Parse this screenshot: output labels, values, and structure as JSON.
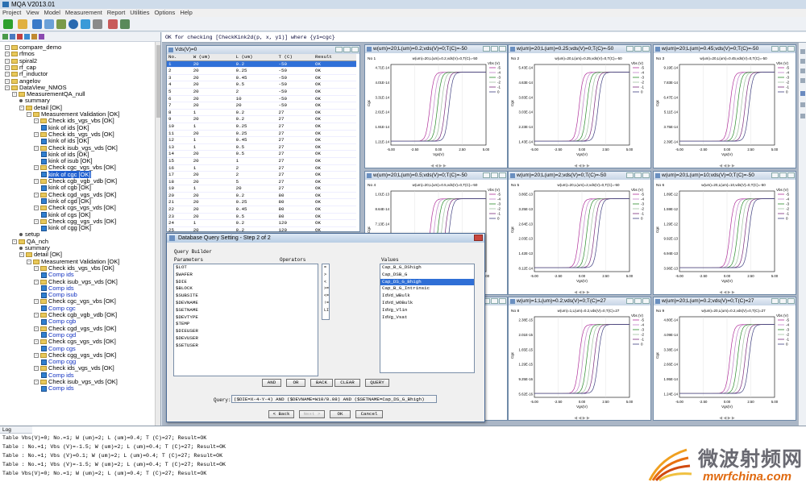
{
  "app": {
    "title": "MQA V2013.01"
  },
  "menu": [
    "Project",
    "View",
    "Model",
    "Measurement",
    "Report",
    "Utilities",
    "Options",
    "Help"
  ],
  "query_expression": "OK for checking [CheckKink2d(p, x, y1)] where {y1=cgc}",
  "tree": [
    {
      "label": "compare_demo",
      "depth": 0,
      "type": "folder"
    },
    {
      "label": "rfmos",
      "depth": 0,
      "type": "folder"
    },
    {
      "label": "spiral2",
      "depth": 0,
      "type": "folder"
    },
    {
      "label": "rf_cap",
      "depth": 0,
      "type": "folder"
    },
    {
      "label": "rf_inductor",
      "depth": 0,
      "type": "folder"
    },
    {
      "label": "angelov",
      "depth": 0,
      "type": "folder"
    },
    {
      "label": "DataView_NMOS",
      "depth": 0,
      "type": "folder"
    },
    {
      "label": "MeasurementQA_null",
      "depth": 1,
      "type": "folder"
    },
    {
      "label": "summary",
      "depth": 2,
      "type": "leaf"
    },
    {
      "label": "detail [OK]",
      "depth": 2,
      "type": "folder"
    },
    {
      "label": "Measurement Validation [OK]",
      "depth": 3,
      "type": "folder"
    },
    {
      "label": "Check ids_vgs_vbs [OK]",
      "depth": 4,
      "type": "folder"
    },
    {
      "label": "kink of ids [OK]",
      "depth": 5,
      "type": "check"
    },
    {
      "label": "Check ids_vgs_vds [OK]",
      "depth": 4,
      "type": "folder"
    },
    {
      "label": "kink of ids [OK]",
      "depth": 5,
      "type": "check"
    },
    {
      "label": "Check isub_vgs_vds [OK]",
      "depth": 4,
      "type": "folder"
    },
    {
      "label": "kink of ids [OK]",
      "depth": 5,
      "type": "check"
    },
    {
      "label": "kink of isub [OK]",
      "depth": 5,
      "type": "check"
    },
    {
      "label": "Check cgc_vgs_vbs [OK]",
      "depth": 4,
      "type": "folder"
    },
    {
      "label": "kink of cgc [OK]",
      "depth": 5,
      "type": "check",
      "selected": true
    },
    {
      "label": "Check cgb_vgb_vdb [OK]",
      "depth": 4,
      "type": "folder"
    },
    {
      "label": "kink of cgb [OK]",
      "depth": 5,
      "type": "check"
    },
    {
      "label": "Check cgd_vgs_vds [OK]",
      "depth": 4,
      "type": "folder"
    },
    {
      "label": "kink of cgd [OK]",
      "depth": 5,
      "type": "check"
    },
    {
      "label": "Check cgs_vgs_vds [OK]",
      "depth": 4,
      "type": "folder"
    },
    {
      "label": "kink of cgs [OK]",
      "depth": 5,
      "type": "check"
    },
    {
      "label": "Check cgg_vgs_vds [OK]",
      "depth": 4,
      "type": "folder"
    },
    {
      "label": "kink of cgg [OK]",
      "depth": 5,
      "type": "check"
    },
    {
      "label": "setup",
      "depth": 2,
      "type": "leaf"
    },
    {
      "label": "QA_nch",
      "depth": 1,
      "type": "folder"
    },
    {
      "label": "summary",
      "depth": 2,
      "type": "leaf"
    },
    {
      "label": "detail [OK]",
      "depth": 2,
      "type": "folder"
    },
    {
      "label": "Measurement Validation [OK]",
      "depth": 3,
      "type": "folder"
    },
    {
      "label": "Check ids_vgs_vbs [OK]",
      "depth": 4,
      "type": "folder"
    },
    {
      "label": "Comp ids",
      "depth": 5,
      "type": "comp"
    },
    {
      "label": "Check isub_vgs_vds [OK]",
      "depth": 4,
      "type": "folder"
    },
    {
      "label": "Comp ids",
      "depth": 5,
      "type": "comp"
    },
    {
      "label": "Comp isub",
      "depth": 5,
      "type": "comp"
    },
    {
      "label": "Check cgc_vgs_vbs [OK]",
      "depth": 4,
      "type": "folder"
    },
    {
      "label": "Comp cgc",
      "depth": 5,
      "type": "comp"
    },
    {
      "label": "Check cgb_vgb_vdb [OK]",
      "depth": 4,
      "type": "folder"
    },
    {
      "label": "Comp cgb",
      "depth": 5,
      "type": "comp"
    },
    {
      "label": "Check cgd_vgs_vds [OK]",
      "depth": 4,
      "type": "folder"
    },
    {
      "label": "Comp cgd",
      "depth": 5,
      "type": "comp"
    },
    {
      "label": "Check cgs_vgs_vds [OK]",
      "depth": 4,
      "type": "folder"
    },
    {
      "label": "Comp cgs",
      "depth": 5,
      "type": "comp"
    },
    {
      "label": "Check cgg_vgs_vds [OK]",
      "depth": 4,
      "type": "folder"
    },
    {
      "label": "Comp cgg",
      "depth": 5,
      "type": "comp"
    },
    {
      "label": "Check ids_vgs_vds [OK]",
      "depth": 4,
      "type": "folder"
    },
    {
      "label": "Comp ids",
      "depth": 5,
      "type": "comp"
    },
    {
      "label": "Check isub_vgs_vds [OK]",
      "depth": 4,
      "type": "folder"
    },
    {
      "label": "Comp ids",
      "depth": 5,
      "type": "comp"
    }
  ],
  "table_window": {
    "title": "Vds(V)=0",
    "columns": [
      "No.",
      "W (um)",
      "L (um)",
      "T (C)",
      "Result"
    ],
    "rows": [
      [
        "1",
        "20",
        "0.2",
        "-50",
        "OK"
      ],
      [
        "2",
        "20",
        "0.25",
        "-50",
        "OK"
      ],
      [
        "3",
        "20",
        "0.45",
        "-50",
        "OK"
      ],
      [
        "4",
        "20",
        "0.5",
        "-50",
        "OK"
      ],
      [
        "5",
        "20",
        "2",
        "-50",
        "OK"
      ],
      [
        "6",
        "20",
        "10",
        "-50",
        "OK"
      ],
      [
        "7",
        "20",
        "20",
        "-50",
        "OK"
      ],
      [
        "8",
        "1",
        "0.2",
        "27",
        "OK"
      ],
      [
        "9",
        "20",
        "0.2",
        "27",
        "OK"
      ],
      [
        "10",
        "1",
        "0.25",
        "27",
        "OK"
      ],
      [
        "11",
        "20",
        "0.25",
        "27",
        "OK"
      ],
      [
        "12",
        "1",
        "0.45",
        "27",
        "OK"
      ],
      [
        "13",
        "1",
        "0.5",
        "27",
        "OK"
      ],
      [
        "14",
        "20",
        "0.5",
        "27",
        "OK"
      ],
      [
        "15",
        "20",
        "1",
        "27",
        "OK"
      ],
      [
        "16",
        "1",
        "2",
        "27",
        "OK"
      ],
      [
        "17",
        "20",
        "2",
        "27",
        "OK"
      ],
      [
        "18",
        "20",
        "5",
        "27",
        "OK"
      ],
      [
        "19",
        "1",
        "20",
        "27",
        "OK"
      ],
      [
        "20",
        "20",
        "0.2",
        "80",
        "OK"
      ],
      [
        "21",
        "20",
        "0.25",
        "80",
        "OK"
      ],
      [
        "22",
        "20",
        "0.45",
        "80",
        "OK"
      ],
      [
        "23",
        "20",
        "0.5",
        "80",
        "OK"
      ],
      [
        "24",
        "1",
        "0.2",
        "120",
        "OK"
      ],
      [
        "25",
        "20",
        "0.2",
        "120",
        "OK"
      ]
    ]
  },
  "plots": [
    {
      "title": "w(um)=20;L(um)=0.2;vds(V)=0;T(C)=-50",
      "no": "No 1",
      "header": "w(um)=20,L(um)=0.2,vds(V)=0,T(C)=-50",
      "yticks": [
        "4.71E-14",
        "4.01E-14",
        "3.31E-14",
        "2.61E-14",
        "1.91E-14",
        "1.21E-14"
      ]
    },
    {
      "title": "w(um)=20;L(um)=0.25;vds(V)=0;T(C)=-50",
      "no": "No 2",
      "header": "w(um)=20,L(um)=0.25,vds(V)=0,T(C)=-50",
      "yticks": [
        "5.43E-14",
        "4.63E-14",
        "3.83E-14",
        "3.03E-14",
        "2.23E-14",
        "1.43E-14"
      ]
    },
    {
      "title": "w(um)=20;L(um)=0.45;vds(V)=0;T(C)=-50",
      "no": "No 3",
      "header": "w(um)=20,L(um)=0.45,vds(V)=0,T(C)=-50",
      "yticks": [
        "9.19E-14",
        "7.83E-14",
        "6.47E-14",
        "5.11E-14",
        "3.75E-14",
        "2.39E-14"
      ]
    },
    {
      "title": "w(um)=20;L(um)=0.5;vds(V)=0;T(C)=-50",
      "no": "No 4",
      "header": "w(um)=20,L(um)=0.5,vds(V)=0,T(C)=-50",
      "yticks": [
        "1.01E-13",
        "8.64E-14",
        "7.13E-14",
        "5.63E-14",
        "4.12E-14",
        "2.62E-14"
      ]
    },
    {
      "title": "w(um)=20;L(um)=2;vds(V)=0;T(C)=-50",
      "no": "No 5",
      "header": "w(um)=20,L(um)=2,vds(V)=0,T(C)=-50",
      "yticks": [
        "3.86E-13",
        "3.25E-13",
        "2.64E-13",
        "2.03E-13",
        "1.42E-13",
        "8.12E-14"
      ]
    },
    {
      "title": "w(um)=20;L(um)=10;vds(V)=0;T(C)=-50",
      "no": "No 6",
      "header": "w(um)=20,L(um)=10,vds(V)=0,T(C)=-50",
      "yticks": [
        "1.89E-12",
        "1.59E-12",
        "1.29E-12",
        "9.92E-13",
        "6.94E-13",
        "3.96E-13"
      ]
    },
    {
      "title": "",
      "no": "",
      "header": "",
      "yticks": []
    },
    {
      "title": "w(um)=1;L(um)=0.2;vds(V)=0;T(C)=27",
      "no": "No 8",
      "header": "w(um)=1,L(um)=0.2,vds(V)=0,T(C)=27",
      "yticks": [
        "2.38E-15",
        "2.01E-15",
        "1.65E-15",
        "1.29E-15",
        "9.25E-16",
        "5.62E-16"
      ]
    },
    {
      "title": "w(um)=20;L(um)=0.2;vds(V)=0;T(C)=27",
      "no": "No 9",
      "header": "w(um)=20,L(um)=0.2,vds(V)=0,T(C)=27",
      "yticks": [
        "4.80E-14",
        "4.09E-14",
        "3.38E-14",
        "2.66E-14",
        "1.95E-14",
        "1.24E-14"
      ]
    }
  ],
  "plot_common": {
    "xticks": [
      "-5.00",
      "-2.50",
      "0.00",
      "2.50",
      "5.00"
    ],
    "xlabel": "Vgs(V)",
    "ylabel": "Cgc",
    "legend_title": "Vbs (V)",
    "legend": [
      "-5",
      "-4",
      "-3",
      "-2",
      "-1",
      "0"
    ],
    "colors": [
      "#b0309a",
      "#c080c8",
      "#2a8a2a",
      "#a0c0a0",
      "#7a2a7a",
      "#404080"
    ]
  },
  "dialog": {
    "title": "Database Query Setting - Step 2 of 2",
    "section": "Query Builder",
    "parameters_label": "Parameters",
    "operators_label": "Operators",
    "values_label": "Values",
    "parameters": [
      "$LOT",
      "$WAFER",
      "$DIE",
      "$BLOCK",
      "$SUBSITE",
      "$DEVNAME",
      "$SETNAME",
      "$DEVTYPE",
      "$TEMP",
      "$DIEUSER",
      "$DEVUSER",
      "$SETUSER"
    ],
    "operators": [
      "=",
      ">",
      "<",
      ">=",
      "<=",
      "!=",
      "LIKE"
    ],
    "values": [
      "Cap_B_G_DShigh",
      "Cap_DSB_G",
      "Cap_DS_G_Bhigh",
      "Cap_B_G_Intrinsic",
      "IdVd_WBulk",
      "IdVd_WOBulk",
      "IdVg_Vlin",
      "IdVg_Vsat"
    ],
    "selected_value_index": 2,
    "buttons": [
      "AND",
      "OR",
      "BACK",
      "CLEAR",
      "QUERY"
    ],
    "query_label": "Query:",
    "query_text": "($DIE=X-4-Y-4) AND ($DEVNAME=W10/0.08) AND ($SETNAME=Cap_DS_G_Bhigh)",
    "nav": {
      "back": "< Back",
      "next": "Next >",
      "ok": "OK",
      "cancel": "Cancel"
    }
  },
  "log": {
    "tab": "Log",
    "lines": [
      "Table Vbs(V)=0; No.=1; W (um)=2; L (um)=0.4; T (C)=27; Result=OK",
      "Table : No.=1; Vbs (V)=-1.5; W (um)=2; L (um)=0.4; T (C)=27; Result=OK",
      "Table : No.=1; Vbs (V)=0.1; W (um)=2; L (um)=0.4; T (C)=27; Result=OK",
      "Table : No.=1; Vbs (V)=-1.5; W (um)=2; L (um)=0.4; T (C)=27; Result=OK",
      "Table Vbs(V)=0; No.=1; W (um)=2; L (um)=0.4; T (C)=27; Result=OK"
    ]
  },
  "watermark": {
    "cn": "微波射频网",
    "en": "mwrfchina.com"
  }
}
